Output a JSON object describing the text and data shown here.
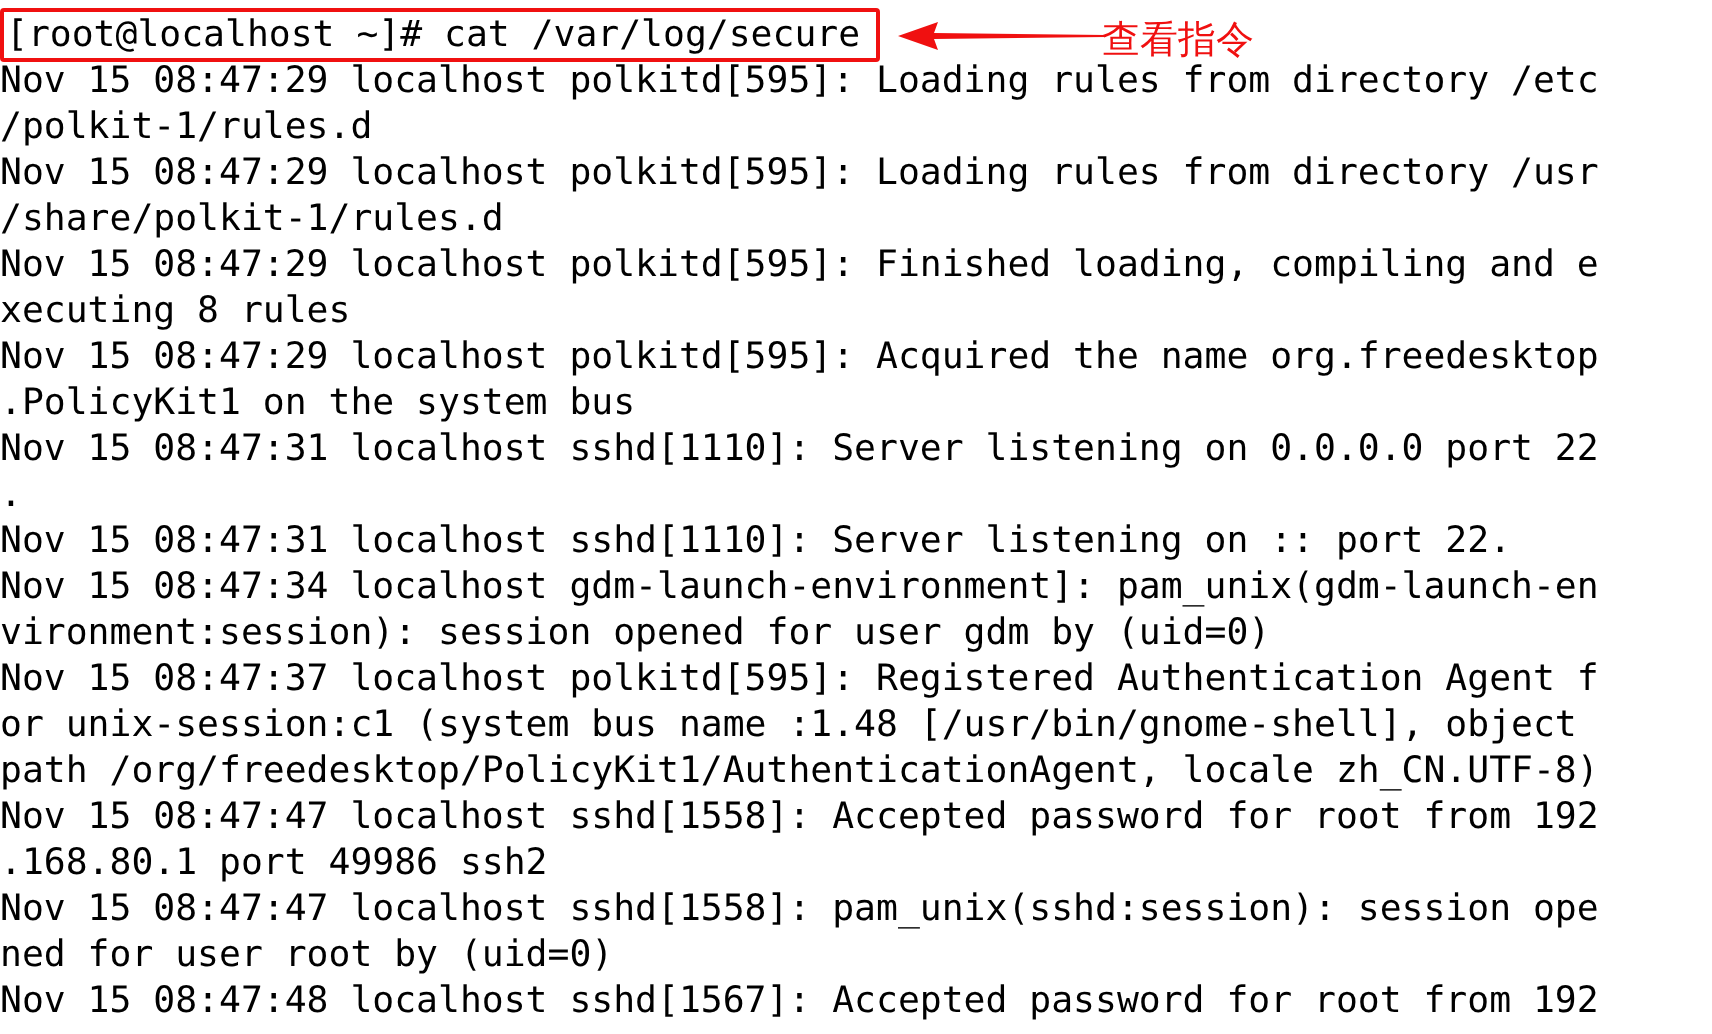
{
  "command_line": "[root@localhost ~]# cat /var/log/secure",
  "annotation": {
    "label": "查看指令"
  },
  "lines": [
    "Nov 15 08:47:29 localhost polkitd[595]: Loading rules from directory /etc",
    "/polkit-1/rules.d",
    "Nov 15 08:47:29 localhost polkitd[595]: Loading rules from directory /usr",
    "/share/polkit-1/rules.d",
    "Nov 15 08:47:29 localhost polkitd[595]: Finished loading, compiling and e",
    "xecuting 8 rules",
    "Nov 15 08:47:29 localhost polkitd[595]: Acquired the name org.freedesktop",
    ".PolicyKit1 on the system bus",
    "Nov 15 08:47:31 localhost sshd[1110]: Server listening on 0.0.0.0 port 22",
    ".",
    "Nov 15 08:47:31 localhost sshd[1110]: Server listening on :: port 22.",
    "Nov 15 08:47:34 localhost gdm-launch-environment]: pam_unix(gdm-launch-en",
    "vironment:session): session opened for user gdm by (uid=0)",
    "Nov 15 08:47:37 localhost polkitd[595]: Registered Authentication Agent f",
    "or unix-session:c1 (system bus name :1.48 [/usr/bin/gnome-shell], object",
    "path /org/freedesktop/PolicyKit1/AuthenticationAgent, locale zh_CN.UTF-8)",
    "Nov 15 08:47:47 localhost sshd[1558]: Accepted password for root from 192",
    ".168.80.1 port 49986 ssh2",
    "Nov 15 08:47:47 localhost sshd[1558]: pam_unix(sshd:session): session ope",
    "ned for user root by (uid=0)",
    "Nov 15 08:47:48 localhost sshd[1567]: Accepted password for root from 192"
  ]
}
